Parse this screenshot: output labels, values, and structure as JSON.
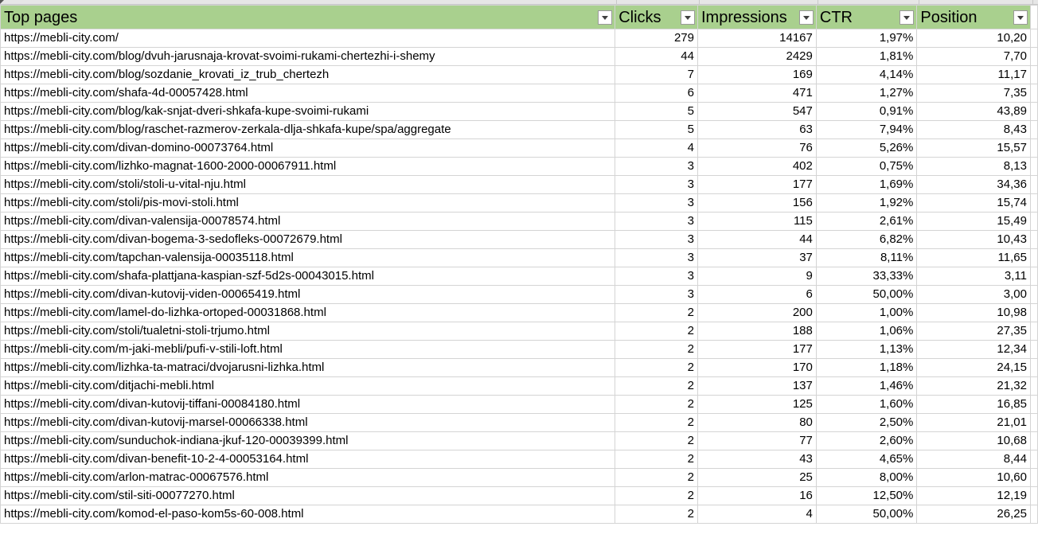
{
  "sheet": {
    "columns": [
      {
        "label": "Top pages",
        "name": "col-top-pages"
      },
      {
        "label": "Clicks",
        "name": "col-clicks"
      },
      {
        "label": "Impressions",
        "name": "col-impressions"
      },
      {
        "label": "CTR",
        "name": "col-ctr"
      },
      {
        "label": "Position",
        "name": "col-position"
      }
    ],
    "rows": [
      [
        "https://mebli-city.com/",
        "279",
        "14167",
        "1,97%",
        "10,20"
      ],
      [
        "https://mebli-city.com/blog/dvuh-jarusnaja-krovat-svoimi-rukami-chertezhi-i-shemy",
        "44",
        "2429",
        "1,81%",
        "7,70"
      ],
      [
        "https://mebli-city.com/blog/sozdanie_krovati_iz_trub_chertezh",
        "7",
        "169",
        "4,14%",
        "11,17"
      ],
      [
        "https://mebli-city.com/shafa-4d-00057428.html",
        "6",
        "471",
        "1,27%",
        "7,35"
      ],
      [
        "https://mebli-city.com/blog/kak-snjat-dveri-shkafa-kupe-svoimi-rukami",
        "5",
        "547",
        "0,91%",
        "43,89"
      ],
      [
        "https://mebli-city.com/blog/raschet-razmerov-zerkala-dlja-shkafa-kupe/spa/aggregate",
        "5",
        "63",
        "7,94%",
        "8,43"
      ],
      [
        "https://mebli-city.com/divan-domino-00073764.html",
        "4",
        "76",
        "5,26%",
        "15,57"
      ],
      [
        "https://mebli-city.com/lizhko-magnat-1600-2000-00067911.html",
        "3",
        "402",
        "0,75%",
        "8,13"
      ],
      [
        "https://mebli-city.com/stoli/stoli-u-vital-nju.html",
        "3",
        "177",
        "1,69%",
        "34,36"
      ],
      [
        "https://mebli-city.com/stoli/pis-movi-stoli.html",
        "3",
        "156",
        "1,92%",
        "15,74"
      ],
      [
        "https://mebli-city.com/divan-valensija-00078574.html",
        "3",
        "115",
        "2,61%",
        "15,49"
      ],
      [
        "https://mebli-city.com/divan-bogema-3-sedofleks-00072679.html",
        "3",
        "44",
        "6,82%",
        "10,43"
      ],
      [
        "https://mebli-city.com/tapchan-valensija-00035118.html",
        "3",
        "37",
        "8,11%",
        "11,65"
      ],
      [
        "https://mebli-city.com/shafa-plattjana-kaspian-szf-5d2s-00043015.html",
        "3",
        "9",
        "33,33%",
        "3,11"
      ],
      [
        "https://mebli-city.com/divan-kutovij-viden-00065419.html",
        "3",
        "6",
        "50,00%",
        "3,00"
      ],
      [
        "https://mebli-city.com/lamel-do-lizhka-ortoped-00031868.html",
        "2",
        "200",
        "1,00%",
        "10,98"
      ],
      [
        "https://mebli-city.com/stoli/tualetni-stoli-trjumo.html",
        "2",
        "188",
        "1,06%",
        "27,35"
      ],
      [
        "https://mebli-city.com/m-jaki-mebli/pufi-v-stili-loft.html",
        "2",
        "177",
        "1,13%",
        "12,34"
      ],
      [
        "https://mebli-city.com/lizhka-ta-matraci/dvojarusni-lizhka.html",
        "2",
        "170",
        "1,18%",
        "24,15"
      ],
      [
        "https://mebli-city.com/ditjachi-mebli.html",
        "2",
        "137",
        "1,46%",
        "21,32"
      ],
      [
        "https://mebli-city.com/divan-kutovij-tiffani-00084180.html",
        "2",
        "125",
        "1,60%",
        "16,85"
      ],
      [
        "https://mebli-city.com/divan-kutovij-marsel-00066338.html",
        "2",
        "80",
        "2,50%",
        "21,01"
      ],
      [
        "https://mebli-city.com/sunduchok-indiana-jkuf-120-00039399.html",
        "2",
        "77",
        "2,60%",
        "10,68"
      ],
      [
        "https://mebli-city.com/divan-benefit-10-2-4-00053164.html",
        "2",
        "43",
        "4,65%",
        "8,44"
      ],
      [
        "https://mebli-city.com/arlon-matrac-00067576.html",
        "2",
        "25",
        "8,00%",
        "10,60"
      ],
      [
        "https://mebli-city.com/stil-siti-00077270.html",
        "2",
        "16",
        "12,50%",
        "12,19"
      ],
      [
        "https://mebli-city.com/komod-el-paso-kom5s-60-008.html",
        "2",
        "4",
        "50,00%",
        "26,25"
      ]
    ]
  },
  "colors": {
    "header_bg": "#a9d08e",
    "grid": "#d4d4d4"
  }
}
